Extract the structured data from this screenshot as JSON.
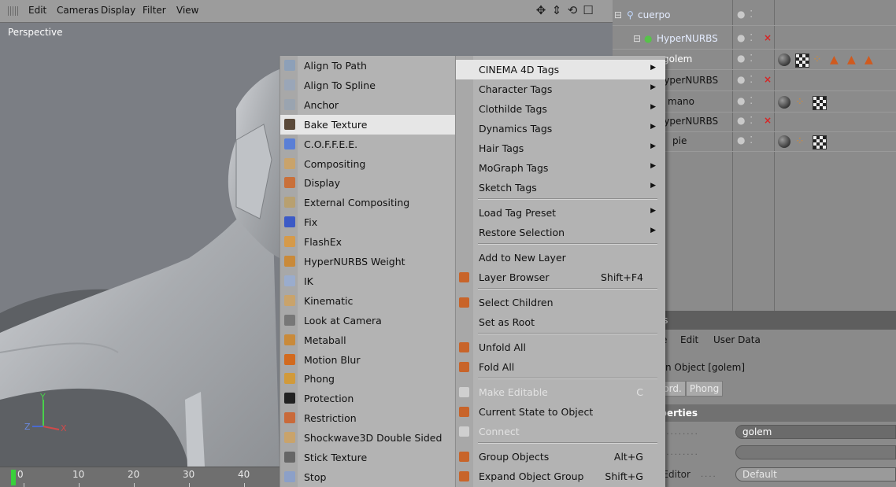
{
  "viewport": {
    "menu": [
      "Edit",
      "Cameras",
      "Display",
      "Filter",
      "View"
    ],
    "label": "Perspective",
    "tools": [
      "move-icon",
      "scale-icon",
      "rotate-icon",
      "maximize-icon"
    ],
    "axis": {
      "y": "Y",
      "z": "Z",
      "x": "X"
    }
  },
  "timeline": {
    "marks": [
      "0",
      "10",
      "20",
      "30",
      "40"
    ],
    "accent": "#39d13b"
  },
  "object_manager": {
    "rows": [
      {
        "name": "cuerpo",
        "flags": "● ⁚",
        "x": false
      },
      {
        "name": "HyperNURBS",
        "flags": "● ⁚",
        "x": true
      },
      {
        "name": "golem",
        "flags": "● ⁚",
        "x": false,
        "tags": [
          "phong-tag",
          "texture-tag",
          "phong-dots-tag",
          "warning-tag",
          "warning-tag",
          "warning-tag"
        ]
      },
      {
        "name": "lyperNURBS",
        "flags": "● ⁚",
        "x": true
      },
      {
        "name": "mano",
        "flags": "● ⁚",
        "x": false,
        "tags": [
          "phong-tag",
          "phong-dots-tag",
          "texture-tag"
        ]
      },
      {
        "name": "lyperNURBS",
        "flags": "● ⁚",
        "x": true
      },
      {
        "name": "pie",
        "flags": "● ⁚",
        "x": false,
        "tags": [
          "phong-tag",
          "phong-dots-tag",
          "texture-tag"
        ]
      }
    ]
  },
  "attributes": {
    "title": "tes",
    "menu": [
      "e",
      "Edit",
      "User Data"
    ],
    "object_name": "gon Object [golem]",
    "tabs": [
      "oord.",
      "Phong"
    ],
    "section": "operties",
    "rows": [
      {
        "label": "",
        "value": "golem"
      },
      {
        "label": "",
        "value": ""
      },
      {
        "label": "h Editor",
        "value": "Default"
      }
    ]
  },
  "tag_menu": {
    "items": [
      {
        "label": "Align To Path",
        "icon": "align-path-icon",
        "color": "#8da0b8"
      },
      {
        "label": "Align To Spline",
        "icon": "align-spline-icon",
        "color": "#9aa6b8"
      },
      {
        "label": "Anchor",
        "icon": "anchor-icon",
        "color": "#9aa4b0"
      },
      {
        "label": "Bake Texture",
        "icon": "bake-texture-icon",
        "color": "#5b4a3a",
        "highlighted": true
      },
      {
        "label": "C.O.F.F.E.E.",
        "icon": "coffee-icon",
        "color": "#5a7fd6"
      },
      {
        "label": "Compositing",
        "icon": "compositing-icon",
        "color": "#c9a36b"
      },
      {
        "label": "Display",
        "icon": "display-icon",
        "color": "#c9703a"
      },
      {
        "label": "External Compositing",
        "icon": "external-compositing-icon",
        "color": "#b8a070"
      },
      {
        "label": "Fix",
        "icon": "fix-icon",
        "color": "#3c5ac6"
      },
      {
        "label": "FlashEx",
        "icon": "flashex-icon",
        "color": "#d59a4a"
      },
      {
        "label": "HyperNURBS Weight",
        "icon": "hypernurbs-weight-icon",
        "color": "#c98a3a"
      },
      {
        "label": "IK",
        "icon": "ik-icon",
        "color": "#9aaccd"
      },
      {
        "label": "Kinematic",
        "icon": "kinematic-icon",
        "color": "#c9a36b"
      },
      {
        "label": "Look at Camera",
        "icon": "look-at-camera-icon",
        "color": "#777"
      },
      {
        "label": "Metaball",
        "icon": "metaball-icon",
        "color": "#c98a3a"
      },
      {
        "label": "Motion Blur",
        "icon": "motion-blur-icon",
        "color": "#d26a1e"
      },
      {
        "label": "Phong",
        "icon": "phong-icon",
        "color": "#d19a3a"
      },
      {
        "label": "Protection",
        "icon": "protection-icon",
        "color": "#222"
      },
      {
        "label": "Restriction",
        "icon": "restriction-icon",
        "color": "#c96a3a"
      },
      {
        "label": "Shockwave3D Double Sided",
        "icon": "shockwave-icon",
        "color": "#c9a36b"
      },
      {
        "label": "Stick Texture",
        "icon": "stick-texture-icon",
        "color": "#666"
      },
      {
        "label": "Stop",
        "icon": "stop-icon",
        "color": "#8ca0c8"
      }
    ]
  },
  "context_menu": {
    "items": [
      {
        "label": "CINEMA 4D Tags",
        "submenu": true,
        "highlighted": true
      },
      {
        "label": "Character Tags",
        "submenu": true
      },
      {
        "label": "Clothilde Tags",
        "submenu": true
      },
      {
        "label": "Dynamics Tags",
        "submenu": true
      },
      {
        "label": "Hair Tags",
        "submenu": true
      },
      {
        "label": "MoGraph Tags",
        "submenu": true
      },
      {
        "label": "Sketch Tags",
        "submenu": true
      },
      {
        "label": "Load Tag Preset",
        "submenu": true,
        "sep_before": true
      },
      {
        "label": "Restore Selection",
        "submenu": true
      },
      {
        "label": "Add to New Layer",
        "sep_before": true
      },
      {
        "label": "Layer Browser",
        "shortcut": "Shift+F4",
        "icon": "layer-browser-icon"
      },
      {
        "label": "Select Children",
        "icon": "select-children-icon",
        "sep_before": true
      },
      {
        "label": "Set as Root"
      },
      {
        "label": "Unfold All",
        "icon": "unfold-all-icon",
        "sep_before": true
      },
      {
        "label": "Fold All",
        "icon": "fold-all-icon"
      },
      {
        "label": "Make Editable",
        "shortcut": "C",
        "icon": "make-editable-icon",
        "disabled": true,
        "sep_before": true
      },
      {
        "label": "Current State to Object",
        "icon": "current-state-icon"
      },
      {
        "label": "Connect",
        "icon": "connect-icon",
        "disabled": true
      },
      {
        "label": "Group Objects",
        "shortcut": "Alt+G",
        "icon": "group-objects-icon",
        "sep_before": true
      },
      {
        "label": "Expand Object Group",
        "shortcut": "Shift+G",
        "icon": "expand-group-icon"
      }
    ]
  }
}
